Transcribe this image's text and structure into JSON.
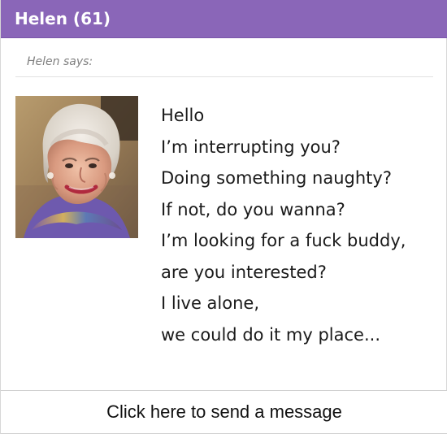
{
  "header": {
    "title": "Helen (61)",
    "background_color": "#8a66b8"
  },
  "sender": {
    "says_label": "Helen says:",
    "avatar_description": "profile photo"
  },
  "message": {
    "lines": [
      "Hello",
      "I’m interrupting you?",
      "Doing something naughty?",
      "If not, do you wanna?",
      "I’m looking for a fuck buddy,",
      "are you interested?",
      "I live alone,",
      "we could do it my place..."
    ]
  },
  "footer": {
    "cta_label": "Click here to send a message"
  }
}
